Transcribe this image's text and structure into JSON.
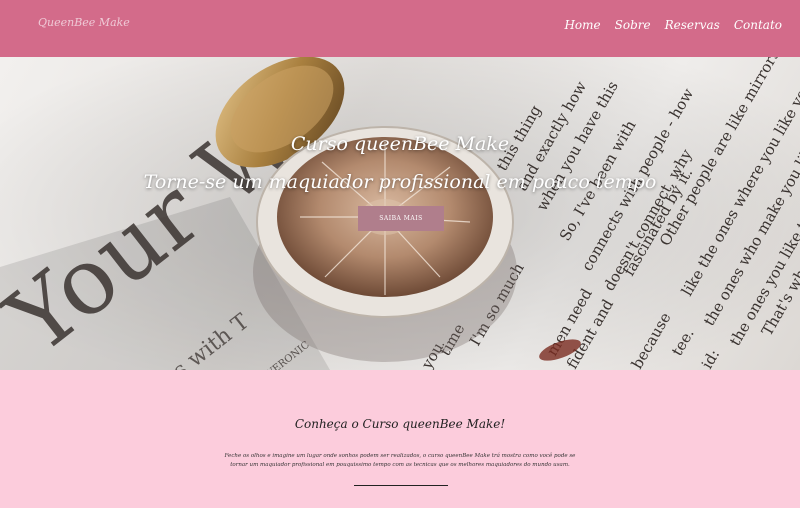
{
  "header": {
    "logo": "QueenBee Make",
    "nav": [
      "Home",
      "Sobre",
      "Reservas",
      "Contato"
    ]
  },
  "hero": {
    "title": "Curso queenBee Make",
    "subtitle": "Torne-se um maquiador profissional em pouco tempo",
    "cta_label": "SAIBA MAIS",
    "background_text": [
      "Your W",
      "es with T",
      "VERONIC",
      "this thing",
      "and exactly how",
      "when you have this",
      "So, I've been with",
      "connects with people - how",
      "doesn't connect, why",
      "fascinated by it.",
      "Other people are like mirrors are",
      "like the ones where you like your",
      "the ones who make you like yo",
      "the ones you like to be",
      "That's why we",
      "men need",
      "fident and",
      "because",
      "tee.",
      "id:",
      "I'm so much",
      "time",
      "you"
    ]
  },
  "about": {
    "title": "Conheça o Curso queenBee Make!",
    "text": "Feche os olhos e imagine um lugar onde sonhos podem ser realizados, o curso queenBee Make trá mostra como você pode se tornar um maquiador profissional em pouquissimo tempo com as tecnicas que os melhores maquiadores do mundo usam."
  },
  "colors": {
    "navbar": "#d36b8a",
    "page_background": "#fcccdc",
    "cta_button": "#b07e8c"
  }
}
